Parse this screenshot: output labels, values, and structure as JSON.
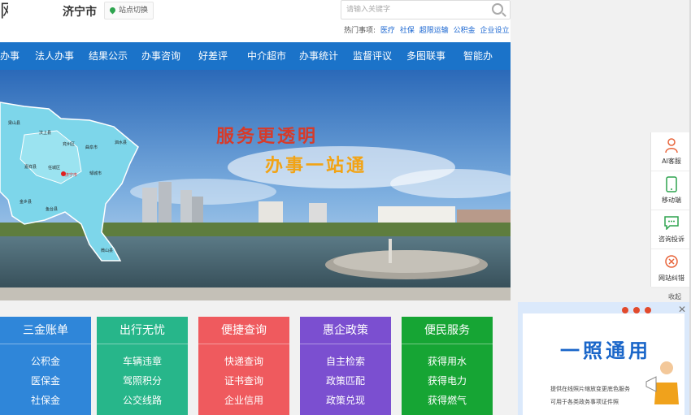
{
  "header": {
    "logo_fragment": "网",
    "city": "济宁市",
    "switch_label": "站点切换",
    "search_placeholder": "请输入关键字",
    "hot_label": "热门事项:",
    "hot_links": [
      "医疗",
      "社保",
      "超限运输",
      "公积金",
      "企业设立"
    ]
  },
  "nav": {
    "items": [
      "办事",
      "法人办事",
      "结果公示",
      "办事咨询",
      "好差评",
      "中介超市",
      "办事统计",
      "监督评议",
      "多图联事",
      "智能办"
    ]
  },
  "banner": {
    "slogan1": "服务更透明",
    "slogan2": "办事一站通",
    "map_labels": [
      "梁山县",
      "汶上县",
      "兖州区",
      "泗水县",
      "嘉祥县",
      "任城区",
      "曲阜市",
      "济宁市",
      "邹城市",
      "金乡县",
      "鱼台县",
      "微山县"
    ]
  },
  "cards": [
    {
      "title": "三金账单",
      "items": [
        "公积金",
        "医保金",
        "社保金"
      ],
      "color": "#2f86d9"
    },
    {
      "title": "出行无忧",
      "items": [
        "车辆违章",
        "驾照积分",
        "公交线路"
      ],
      "color": "#27b68a"
    },
    {
      "title": "便捷查询",
      "items": [
        "快递查询",
        "证书查询",
        "企业信用"
      ],
      "color": "#ef5a5e"
    },
    {
      "title": "惠企政策",
      "items": [
        "自主检索",
        "政策匹配",
        "政策兑现"
      ],
      "color": "#7b4fd0"
    },
    {
      "title": "便民服务",
      "items": [
        "获得用水",
        "获得电力",
        "获得燃气"
      ],
      "color": "#16a534"
    }
  ],
  "sidebar": {
    "items": [
      {
        "label": "AI客服",
        "icon": "robot-icon"
      },
      {
        "label": "移动端",
        "icon": "mobile-icon"
      },
      {
        "label": "咨询投诉",
        "icon": "chat-icon"
      },
      {
        "label": "网站纠错",
        "icon": "correction-icon"
      }
    ],
    "collapse": "收起"
  },
  "popup": {
    "title": "一照通用",
    "line1": "提供在线照片缩放变更底色服务",
    "line2": "可用于各类政务事项证件照"
  }
}
